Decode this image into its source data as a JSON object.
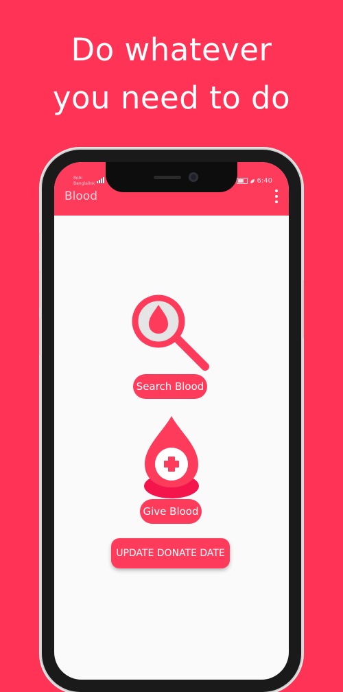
{
  "promo": {
    "headline_line1": "Do whatever",
    "headline_line2": "you need to do"
  },
  "status_bar": {
    "carrier_line1": "Robi",
    "carrier_line2": "Banglalink",
    "battery_label": "battery-icon",
    "time": "6:40"
  },
  "app_bar": {
    "title": "Blood",
    "menu_icon": "more-vert-icon"
  },
  "main": {
    "search_icon": "blood-search-icon",
    "search_label": "Search Blood",
    "donate_icon": "blood-donate-icon",
    "give_label": "Give Blood",
    "update_label": "UPDATE DONATE DATE"
  },
  "colors": {
    "background": "#ff3355",
    "primary": "#ff3b5c",
    "screen_bg": "#fafafa"
  }
}
